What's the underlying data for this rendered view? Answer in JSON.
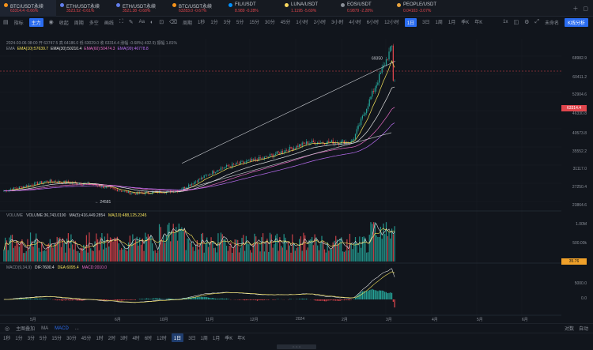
{
  "tabs": [
    {
      "symbol": "BTC/USDT永续",
      "price": "63314.4 -0.66%",
      "dot": "#f7931a",
      "pxcolor": "#e0464d"
    },
    {
      "symbol": "ETH/USDT永续",
      "price": "3523.52 -0.61%",
      "dot": "#627eea",
      "pxcolor": "#e0464d"
    },
    {
      "symbol": "ETH/USDT永续",
      "price": "3521.38 -0.68%",
      "dot": "#627eea",
      "pxcolor": "#e0464d"
    },
    {
      "symbol": "BTC/USDT永续",
      "price": "63283.0 -0.67%",
      "dot": "#f7931a",
      "pxcolor": "#e0464d"
    },
    {
      "symbol": "FIL/USDT",
      "price": "8.989 -0.28%",
      "dot": "#0090ff",
      "pxcolor": "#e0464d"
    },
    {
      "symbol": "LUNA/USDT",
      "price": "1.1195 -5.69%",
      "dot": "#f9d85e",
      "pxcolor": "#e0464d"
    },
    {
      "symbol": "EOS/USDT",
      "price": "0.9879 -2.28%",
      "dot": "#8a8f98",
      "pxcolor": "#e0464d"
    },
    {
      "symbol": "PEOPLE/USDT",
      "price": "0.04103 -3.07%",
      "dot": "#e8a33d",
      "pxcolor": "#e0464d"
    }
  ],
  "toolbar1": {
    "items": [
      "指标",
      "主图",
      "收起",
      "周期",
      "多空",
      "画线",
      "Aa",
      "1秒",
      "1分",
      "3分",
      "5分",
      "15分",
      "30分",
      "1小时",
      "2小时",
      "4小时",
      "6小时",
      "12小时",
      "1日",
      "3日",
      "1周",
      "月K"
    ],
    "left_labels": [
      "指标",
      "主力",
      "收起"
    ],
    "interval_labels": [
      "1秒",
      "1分",
      "3分",
      "5分",
      "15分",
      "30分",
      "45分",
      "1小时",
      "2小时",
      "3小时",
      "4小时",
      "6小时",
      "12小时",
      "1日",
      "3日",
      "1周",
      "1月",
      "季K",
      "年K"
    ],
    "active": "1日"
  },
  "toolbar2": {
    "items": [
      "周期",
      "1秒",
      "1分",
      "3分",
      "5分",
      "15分",
      "30分",
      "45分",
      "1时",
      "2时",
      "3时",
      "4时",
      "6时",
      "12时",
      "1日",
      "3日",
      "1周",
      "1月",
      "季K",
      "年K"
    ],
    "right": [
      "未命名",
      "K线分析"
    ],
    "zoom": "1x"
  },
  "ohlc": {
    "line": "2024-03-06 08:00  开 63747.5  高 64186.0  低 63029.0  收 63314.4  涨幅 -0.68%(-432.9)  振幅 1.81%",
    "ema": "EMA",
    "ema_labels": [
      "EMA(10):57639.7",
      "EMA(30):50210.4",
      "EMA(60):50474.3",
      "EMA(99):46778.8"
    ]
  },
  "price_axis": [
    "68982.9",
    "63314.4",
    "60411.2",
    "52904.6",
    "46330.8",
    "40573.8",
    "35552.2",
    "31117.0",
    "27250.4",
    "23864.6"
  ],
  "current_price": "63314.4",
  "high_label": "69350",
  "low_label": "24581",
  "volume": {
    "title": "VOLUME",
    "value": "VOLUME:36,743.0190",
    "ma5": "MA(5):416,449.2854",
    "ma10": "MA(10):488,125.2345",
    "axis": [
      "1.00M",
      "500.00k"
    ],
    "tag": "35.76"
  },
  "macd": {
    "title": "MACD(9,34,9)",
    "dif": "DIF:7600.4",
    "dea": "DEA:6095.4",
    "macd": "MACD:2010.0",
    "axis": [
      "5000.0",
      "0.0"
    ]
  },
  "time_axis": [
    "5月",
    "6月",
    "10月",
    "11月",
    "12月",
    "2024",
    "2月",
    "3月",
    "4月",
    "5月",
    "6月"
  ],
  "bottom1": {
    "items": [
      "主图叠加",
      "MA",
      "MACD",
      "..."
    ],
    "right": [
      "对数",
      "自动"
    ]
  },
  "bottom2": {
    "items": [
      "1秒",
      "1分",
      "3分",
      "5分",
      "15分",
      "30分",
      "45分",
      "1时",
      "2时",
      "3时",
      "4时",
      "6时",
      "12时",
      "1日",
      "3日",
      "1周",
      "1月",
      "季K",
      "年K"
    ],
    "active": "1日"
  },
  "scroll_label": "⇔⇔⇔",
  "chart_data": {
    "type": "candlestick",
    "title": "",
    "xlabel": "",
    "ylabel": "",
    "ylim": [
      22000,
      71000
    ],
    "x": [
      "2023-06",
      "2023-07",
      "2023-08",
      "2023-09",
      "2023-10",
      "2023-11",
      "2023-12",
      "2024-01",
      "2024-02",
      "2024-03"
    ],
    "series": [
      {
        "values": [
          27000,
          30200,
          29200,
          26100,
          27000,
          34500,
          37800,
          42800,
          43000,
          63314
        ]
      }
    ],
    "annotations": [
      "69350",
      "24581"
    ],
    "colors": {
      "up": "#26a69a",
      "down": "#e0464d",
      "ema10": "#f5e35b",
      "ema30": "#e0e0e0",
      "ema60": "#e86ac4",
      "ema99": "#b86cf0"
    }
  }
}
